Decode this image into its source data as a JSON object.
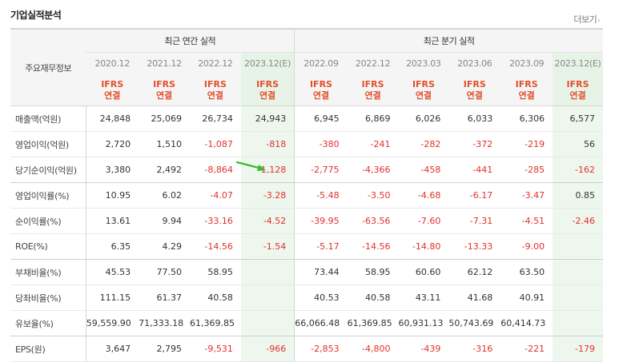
{
  "section": {
    "title": "기업실적분석",
    "more_label": "더보기",
    "more_arrow": "›"
  },
  "table": {
    "label_header": "주요재무정보",
    "annual_header": "최근 연간 실적",
    "quarter_header": "최근 분기 실적",
    "annual_periods": [
      "2020.12",
      "2021.12",
      "2022.12",
      "2023.12(E)"
    ],
    "quarter_periods": [
      "2022.09",
      "2022.12",
      "2023.03",
      "2023.06",
      "2023.09",
      "2023.12(E)"
    ],
    "ifrs_label": "IFRS",
    "ifrs_sub": "연결",
    "estimate_columns": [
      3,
      9
    ],
    "rows": [
      {
        "label": "매출액(억원)",
        "values": [
          "24,848",
          "25,069",
          "26,734",
          "24,943",
          "6,945",
          "6,869",
          "6,026",
          "6,033",
          "6,306",
          "6,577"
        ]
      },
      {
        "label": "영업이익(억원)",
        "values": [
          "2,720",
          "1,510",
          "-1,087",
          "-818",
          "-380",
          "-241",
          "-282",
          "-372",
          "-219",
          "56"
        ]
      },
      {
        "label": "당기순이익(억원)",
        "values": [
          "3,380",
          "2,492",
          "-8,864",
          "-1,128",
          "-2,775",
          "-4,366",
          "-458",
          "-441",
          "-285",
          "-162"
        ]
      },
      {
        "label": "영업이익률(%)",
        "values": [
          "10.95",
          "6.02",
          "-4.07",
          "-3.28",
          "-5.48",
          "-3.50",
          "-4.68",
          "-6.17",
          "-3.47",
          "0.85"
        ]
      },
      {
        "label": "순이익률(%)",
        "values": [
          "13.61",
          "9.94",
          "-33.16",
          "-4.52",
          "-39.95",
          "-63.56",
          "-7.60",
          "-7.31",
          "-4.51",
          "-2.46"
        ]
      },
      {
        "label": "ROE(%)",
        "values": [
          "6.35",
          "4.29",
          "-14.56",
          "-1.54",
          "-5.17",
          "-14.56",
          "-14.80",
          "-13.33",
          "-9.00",
          ""
        ]
      },
      {
        "label": "부채비율(%)",
        "values": [
          "45.53",
          "77.50",
          "58.95",
          "",
          "73.44",
          "58.95",
          "60.60",
          "62.12",
          "63.50",
          ""
        ]
      },
      {
        "label": "당좌비율(%)",
        "values": [
          "111.15",
          "61.37",
          "40.58",
          "",
          "40.53",
          "40.58",
          "43.11",
          "41.68",
          "40.91",
          ""
        ]
      },
      {
        "label": "유보율(%)",
        "values": [
          "59,559.90",
          "71,333.18",
          "61,369.85",
          "",
          "66,066.48",
          "61,369.85",
          "60,931.13",
          "50,743.69",
          "60,414.73",
          ""
        ]
      },
      {
        "label": "EPS(원)",
        "values": [
          "3,647",
          "2,795",
          "-9,531",
          "-966",
          "-2,853",
          "-4,800",
          "-439",
          "-316",
          "-221",
          "-179"
        ]
      }
    ]
  },
  "colors": {
    "negative": "#e2302c",
    "ifrs": "#e2502c",
    "estimate_bg": "#eef7ee",
    "annotation_arrow": "#3dbb2a"
  },
  "annotation": {
    "icon": "green-arrow-icon"
  }
}
